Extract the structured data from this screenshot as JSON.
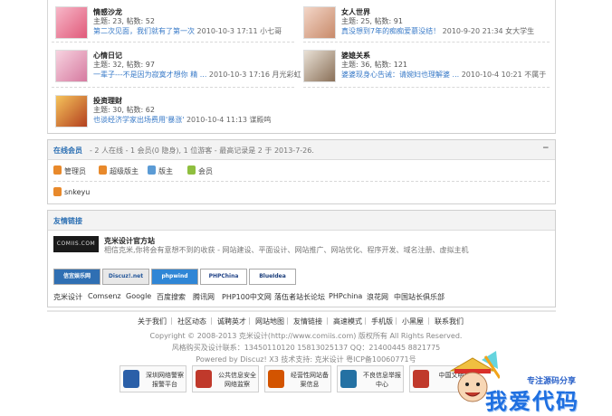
{
  "forums": [
    {
      "name": "情感沙龙",
      "stats": "主题: 23, 帖数: 52",
      "last_title": "第二次见面，我们就有了第一次",
      "last_meta": "2010-10-3 17:11 小七哥",
      "colors": [
        "#f7b7c8",
        "#e05a7a"
      ]
    },
    {
      "name": "女人世界",
      "stats": "主题: 25, 帖数: 91",
      "last_title": "真没想到7年的痴痴爱慕没结！",
      "last_meta": "2010-9-20 21:34 女大学生",
      "colors": [
        "#f3d6c8",
        "#c88a6a"
      ]
    },
    {
      "name": "心情日记",
      "stats": "主题: 32, 帖数: 97",
      "last_title": "一辈子---不是因为寂寞才想你 精 ...",
      "last_meta": "2010-10-3 17:16 月光彩虹",
      "colors": [
        "#f7d3e0",
        "#d67aa0"
      ]
    },
    {
      "name": "婆媳关系",
      "stats": "主题: 36, 帖数: 121",
      "last_title": "婆婆现身心告诫：请婉妇也理解婆 ...",
      "last_meta": "2010-10-4 10:21 不属于",
      "colors": [
        "#e9e1d6",
        "#8a7058"
      ]
    },
    {
      "name": "投资理财",
      "stats": "主题: 30, 帖数: 62",
      "last_title": "也谈经济学家出场费用'暴涨'",
      "last_meta": "2010-10-4 11:13 谋殿鸣",
      "colors": [
        "#f5c35b",
        "#b3401f"
      ]
    }
  ],
  "online": {
    "title": "在线会员",
    "desc": "- 2 人在线 - 1 会员(0 隐身), 1 位游客 - 最高记录是 2 于 2013-7-26.",
    "collapse_icon": "−",
    "legend": [
      {
        "label": "管理员",
        "color": "#e8892b"
      },
      {
        "label": "超级版主",
        "color": "#e8892b"
      },
      {
        "label": "版主",
        "color": "#5b9bd5"
      },
      {
        "label": "会员",
        "color": "#8fbf3f"
      }
    ],
    "members": [
      {
        "name": "snkeyu"
      }
    ]
  },
  "friends": {
    "title": "友情链接",
    "featured": {
      "logo_text": "COMIIS.COM",
      "name": "克米设计官方站",
      "desc": "相信克米,你将会有意想不到的收获 - 网站建设、平面设计、网站推广、网站优化、程序开发、域名注册、虚拟主机"
    },
    "banners": [
      {
        "text": "信宜娱乐网",
        "bg": "#2f6fb3",
        "fg": "#ffffff"
      },
      {
        "text": "Discuz!.net",
        "bg": "#e8e8e8",
        "fg": "#225599"
      },
      {
        "text": "phpwind",
        "bg": "#2f86d6",
        "fg": "#ffffff"
      },
      {
        "text": "PHPChina",
        "bg": "#ffffff",
        "fg": "#224488"
      },
      {
        "text": "BlueIdea",
        "bg": "#ffffff",
        "fg": "#1a3d7a"
      }
    ],
    "text_links": [
      "克米设计",
      "Comsenz",
      "Google",
      "百度搜索",
      "腾讯网",
      "PHP100中文网",
      "落伍者站长论坛",
      "PHPchina",
      "浪花网",
      "中国站长俱乐部"
    ]
  },
  "footer": {
    "nav": [
      "关于我们",
      "社区动态",
      "诚聘英才",
      "网站地图",
      "友情链接",
      "高速模式",
      "手机版",
      "小黑屋",
      "联系我们"
    ],
    "copyright": "Copyright © 2008-2013 克米设计(http://www.comiis.com) 版权所有 All Rights Reserved.",
    "contact": "风格购买及设计联系：13450110120 15813025137 QQ：21400445 8821775",
    "powered": "Powered by Discuz! X3  技术支持: 克米设计  粤ICP备10060771号",
    "badges": [
      {
        "text": "深圳网络警察报警平台",
        "color": "#2a5fa8"
      },
      {
        "text": "公共信息安全网络监察",
        "color": "#c0392b"
      },
      {
        "text": "经营性网站备案信息",
        "color": "#d35400"
      },
      {
        "text": "不良信息举报中心",
        "color": "#2471a3"
      },
      {
        "text": "中国文明网",
        "color": "#c0392b"
      }
    ]
  },
  "watermark": {
    "tag": "专注源码分享",
    "big": "我爱代码"
  }
}
